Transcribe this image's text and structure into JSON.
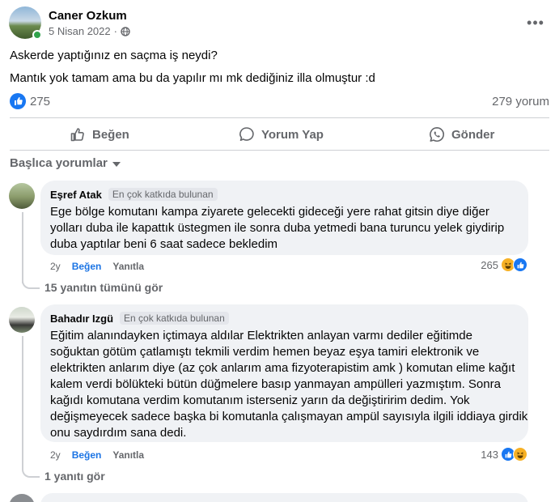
{
  "post": {
    "author": "Caner Ozkum",
    "date": "5 Nisan 2022",
    "privacy_separator": "·",
    "more_label": "•••",
    "text_lines": [
      "Askerde yaptığınız en saçma iş neydi?",
      "Mantık yok tamam ama bu da yapılır mı mk dediğiniz illa olmuştur :d"
    ],
    "like_count": "275",
    "comment_count": "279 yorum"
  },
  "actions": {
    "like": "Beğen",
    "comment": "Yorum Yap",
    "share": "Gönder"
  },
  "comments_filter": "Başlıca yorumlar",
  "comments": [
    {
      "name": "Eşref Atak",
      "badge": "En çok katkıda bulunan",
      "lines": [
        "Ege bölge komutanı kampa ziyarete gelecekti gideceği yere rahat gitsin diye diğer",
        "yolları duba ile kapattık üstegmen ile sonra duba yetmedi bana turuncu yelek giydirip",
        "duba yaptılar beni 6 saat sadece bekledim"
      ],
      "age": "2y",
      "like_label": "Beğen",
      "reply_label": "Yanıtla",
      "reaction_count": "265",
      "replies_label": "15 yanıtın tümünü gör"
    },
    {
      "name": "Bahadır Izgü",
      "badge": "En çok katkıda bulunan",
      "lines": [
        "Eğitim alanındayken içtimaya aldılar Elektrikten anlayan varmı dediler eğitimde",
        "soğuktan götüm çatlamıştı tekmili verdim hemen beyaz eşya tamiri elektronik ve",
        "elektrikten anlarım diye (az çok anlarım ama fizyoterapistim amk ) komutan elime kağıt",
        "kalem verdi bölükteki bütün düğmelere basıp yanmayan ampülleri yazmıştım. Sonra",
        "kağıdı komutana verdim komutanım isterseniz yarın da değiştiririm dedim. Yok",
        "değişmeyecek sadece başka bi komutanla çalışmayan ampül sayısıyla ilgili iddiaya girdik",
        "onu saydırdım sana dedi."
      ],
      "age": "2y",
      "like_label": "Beğen",
      "reply_label": "Yanıtla",
      "reaction_count": "143",
      "replies_label": "1 yanıtı gör"
    }
  ],
  "icons": {
    "globe": "globe-icon",
    "like": "thumbs-up-icon",
    "comment": "speech-bubble-icon",
    "share": "whatsapp-icon",
    "caret": "chevron-down-icon",
    "haha": "laughing-face-icon"
  },
  "colors": {
    "accent": "#1877f2",
    "muted": "#65676b",
    "bubble": "#f0f2f5",
    "online": "#31a24c"
  }
}
